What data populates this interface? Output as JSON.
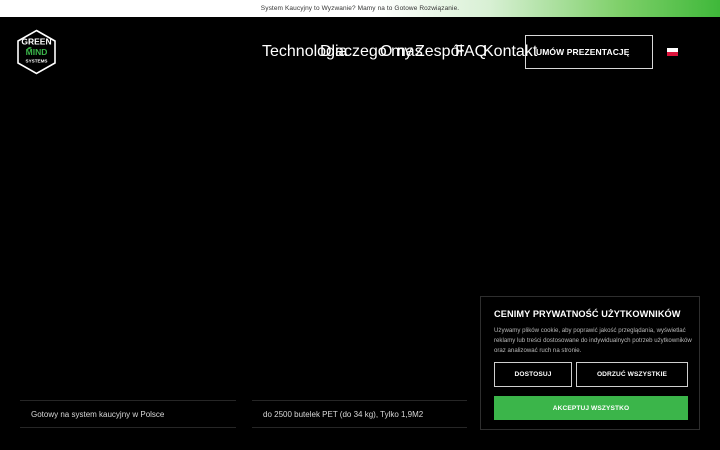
{
  "topbar": {
    "text": "System Kaucyjny to Wyzwanie? Mamy na to Gotowe Rozwiązanie."
  },
  "logo": {
    "line1": "GREEN",
    "line2": "MIND",
    "line3": "SYSTEMS"
  },
  "nav": {
    "items": [
      {
        "label": "Technologia"
      },
      {
        "label": "Dlaczego my"
      },
      {
        "label": "O nas"
      },
      {
        "label": "Zespół"
      },
      {
        "label": "FAQ"
      },
      {
        "label": "Kontakt"
      }
    ],
    "cta_label": "UMÓW PREZENTACJĘ",
    "language": "pl"
  },
  "features": [
    {
      "text": "Gotowy na system kaucyjny w Polsce"
    },
    {
      "text": "do 2500 butelek PET (do 34 kg), Tylko 1,9M2"
    }
  ],
  "cookie": {
    "title": "CENIMY PRYWATNOŚĆ UŻYTKOWNIKÓW",
    "text": "Używamy plików cookie, aby poprawić jakość przeglądania, wyświetlać reklamy lub treści dostosowane do indywidualnych potrzeb użytkowników oraz analizować ruch na stronie.",
    "customize_label": "DOSTOSUJ",
    "reject_label": "ODRZUĆ WSZYSTKIE",
    "accept_label": "AKCEPTUJ WSZYSTKO"
  },
  "colors": {
    "accent": "#3bb54a",
    "background": "#000000"
  }
}
